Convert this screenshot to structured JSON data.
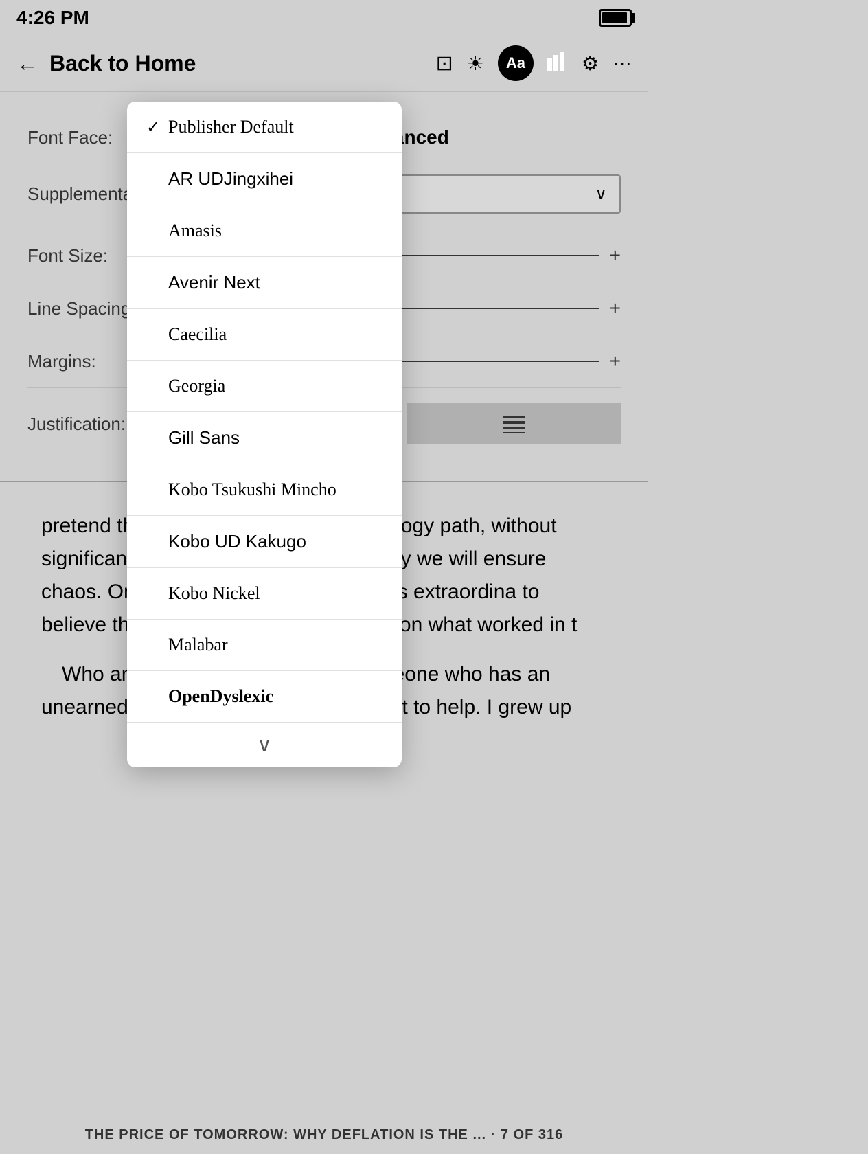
{
  "status": {
    "time": "4:26 PM"
  },
  "nav": {
    "back_label": "Back to Home",
    "icons": {
      "orientation": "⊡",
      "brightness": "☀",
      "font": "Aa",
      "stats": "▌▌",
      "settings": "⚙",
      "more": "···"
    }
  },
  "settings": {
    "tabs": [
      "",
      "Advanced"
    ],
    "rows": [
      {
        "label": "Font Face:",
        "type": "dropdown",
        "value": "Publisher Default"
      },
      {
        "label": "Supplemental:",
        "type": "dropdown",
        "value": ""
      },
      {
        "label": "Font Size:",
        "type": "slider"
      },
      {
        "label": "Line Spacing:",
        "type": "slider"
      },
      {
        "label": "Margins:",
        "type": "slider"
      },
      {
        "label": "Justification:",
        "type": "justify"
      }
    ]
  },
  "font_dropdown": {
    "items": [
      {
        "label": "Publisher Default",
        "selected": true
      },
      {
        "label": "AR UDJingxihei",
        "selected": false
      },
      {
        "label": "Amasis",
        "selected": false
      },
      {
        "label": "Avenir Next",
        "selected": false
      },
      {
        "label": "Caecilia",
        "selected": false
      },
      {
        "label": "Georgia",
        "selected": false
      },
      {
        "label": "Gill Sans",
        "selected": false
      },
      {
        "label": "Kobo Tsukushi Mincho",
        "selected": false
      },
      {
        "label": "Kobo UD Kakugo",
        "selected": false
      },
      {
        "label": "Kobo Nickel",
        "selected": false
      },
      {
        "label": "Malabar",
        "selected": false
      },
      {
        "label": "OpenDyslexic",
        "selected": false
      }
    ],
    "show_more": "∨"
  },
  "book_content": {
    "paragraphs": [
      "pretend the way did in an era before technology path, without significant k about economics and the way we es will ensure chaos. On this pat set to explode. In this extraordina e to believe that what will work i rily be built on what worked in t",
      "Who am I to be saying this? I'm someone who has an unearned advantage and wants to use it to help. I grew up"
    ],
    "footer": "THE PRICE OF TOMORROW: WHY DEFLATION IS THE ... · 7 OF 316"
  }
}
